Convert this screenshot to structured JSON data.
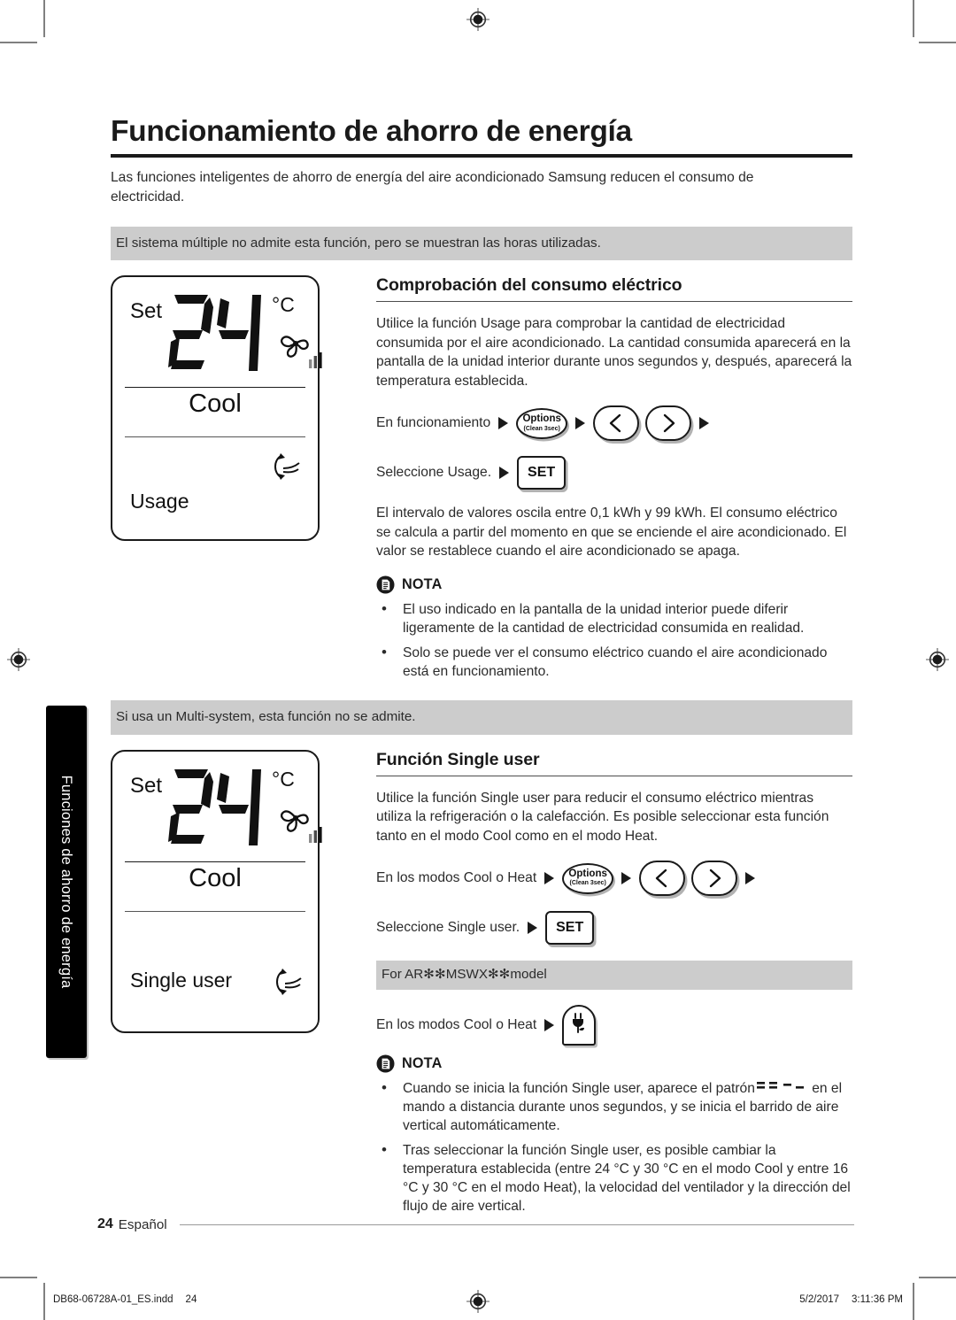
{
  "document": {
    "page_number": "24",
    "language_label": "Español",
    "sidebar_tab_label": "Funciones de ahorro de energía",
    "print_file": "DB68-06728A-01_ES.indd",
    "print_page": "24",
    "print_date": "5/2/2017",
    "print_time": "3:11:36 PM"
  },
  "page": {
    "title": "Funcionamiento de ahorro de energía",
    "intro": "Las funciones inteligentes de ahorro de energía del aire acondicionado Samsung reducen el consumo de electricidad.",
    "banner_1": "El sistema múltiple no admite esta función, pero se muestran las horas utilizadas.",
    "banner_2": "Si usa un Multi-system, esta función no se admite."
  },
  "lcd_usage": {
    "set_label": "Set",
    "temperature": "24",
    "unit": "°C",
    "mode": "Cool",
    "bottom_label": "Usage",
    "fan_icon": "fan-icon",
    "fan_bars_icon": "fan-speed-bars-icon",
    "swing_icon": "vertical-airflow-swing-icon"
  },
  "lcd_single": {
    "set_label": "Set",
    "temperature": "24",
    "unit": "°C",
    "mode": "Cool",
    "bottom_label": "Single user",
    "fan_icon": "fan-icon",
    "fan_bars_icon": "fan-speed-bars-icon",
    "swing_icon": "vertical-airflow-swing-icon"
  },
  "section_usage": {
    "title": "Comprobación del consumo eléctrico",
    "paragraph_1": "Utilice la función Usage para comprobar la cantidad de electricidad consumida por el aire acondicionado. La cantidad consumida aparecerá en la pantalla de la unidad interior durante unos segundos y, después, aparecerá la temperatura establecida.",
    "step_1_text": "En funcionamiento",
    "step_2_text": "Seleccione Usage.",
    "paragraph_2": "El intervalo de valores oscila entre 0,1 kWh y 99 kWh. El consumo eléctrico se calcula a partir del momento en que se enciende el aire acondicionado. El valor se restablece cuando el aire acondicionado se apaga.",
    "nota_label": "NOTA",
    "nota_items": [
      "El uso indicado en la pantalla de la unidad interior puede diferir ligeramente de la cantidad de electricidad consumida en realidad.",
      "Solo se puede ver el consumo eléctrico cuando el aire acondicionado está en funcionamiento."
    ]
  },
  "section_single": {
    "title": "Función Single user",
    "paragraph_1": "Utilice la función Single user para reducir el consumo eléctrico mientras utiliza la refrigeración o la calefacción. Es posible seleccionar esta función tanto en el modo Cool como en el modo Heat.",
    "step_1_text": "En los modos Cool o Heat",
    "step_2_text": "Seleccione Single user.",
    "model_banner": "For AR✻✻MSWX✻✻model",
    "step_3_text": "En los modos Cool o Heat",
    "nota_label": "NOTA",
    "nota_item_1_before": "Cuando se inicia la función Single user, aparece el patrón",
    "nota_item_1_after": "en el mando a distancia durante unos segundos, y se inicia el barrido de aire vertical automáticamente.",
    "nota_item_2": "Tras seleccionar la función Single user, es posible cambiar la temperatura establecida (entre 24 °C y 30 °C en el modo Cool y entre 16 °C y 30 °C en el modo Heat), la velocidad del ventilador y la dirección del flujo de aire vertical."
  },
  "buttons": {
    "options_line1": "Options",
    "options_line2": "(Clean 3sec)",
    "set_label": "SET",
    "left_arrow_icon": "chevron-left-icon",
    "right_arrow_icon": "chevron-right-icon",
    "plug_icon": "power-plug-eco-icon"
  },
  "colors": {
    "banner_gray": "#cccccc",
    "ink": "#231f20",
    "tab_black": "#000000",
    "rule_gray": "#9a9a9a"
  }
}
